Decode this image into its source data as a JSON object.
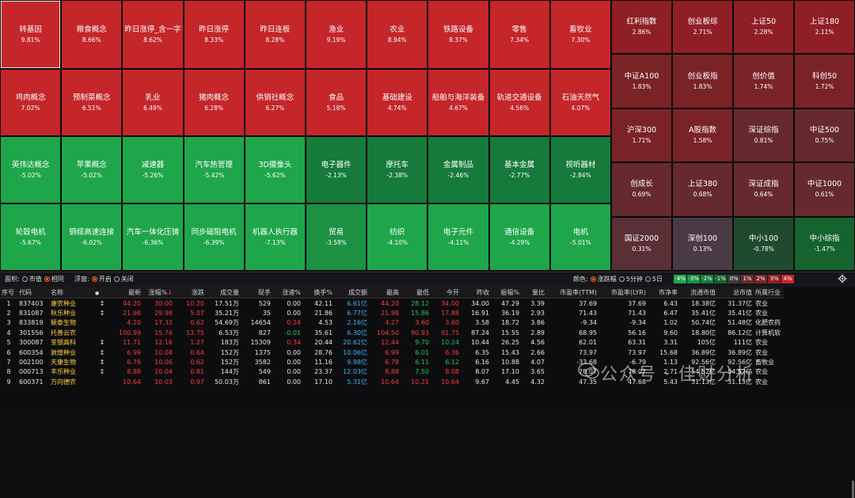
{
  "heatmap": {
    "tiles": [
      {
        "name": "转基因",
        "pct": "9.81%",
        "color": "#c4262a",
        "selected": true
      },
      {
        "name": "粮食概念",
        "pct": "8.66%",
        "color": "#c4262a"
      },
      {
        "name": "昨日涨停_含一字",
        "pct": "8.62%",
        "color": "#c4262a"
      },
      {
        "name": "昨日涨停",
        "pct": "8.33%",
        "color": "#c4262a"
      },
      {
        "name": "昨日连板",
        "pct": "8.28%",
        "color": "#c4262a"
      },
      {
        "name": "渔业",
        "pct": "9.19%",
        "color": "#c4262a"
      },
      {
        "name": "农业",
        "pct": "8.94%",
        "color": "#c4262a"
      },
      {
        "name": "铁路设备",
        "pct": "8.37%",
        "color": "#c4262a"
      },
      {
        "name": "零售",
        "pct": "7.34%",
        "color": "#c4262a"
      },
      {
        "name": "畜牧业",
        "pct": "7.30%",
        "color": "#c4262a"
      },
      {
        "name": "鸡肉概念",
        "pct": "7.02%",
        "color": "#c4262a"
      },
      {
        "name": "预制菜概念",
        "pct": "6.51%",
        "color": "#c4262a"
      },
      {
        "name": "乳业",
        "pct": "6.49%",
        "color": "#c4262a"
      },
      {
        "name": "猪肉概念",
        "pct": "6.28%",
        "color": "#c4262a"
      },
      {
        "name": "供销社概念",
        "pct": "6.27%",
        "color": "#c4262a"
      },
      {
        "name": "食品",
        "pct": "5.18%",
        "color": "#c4262a"
      },
      {
        "name": "基础建设",
        "pct": "4.74%",
        "color": "#c4262a"
      },
      {
        "name": "船舶与海洋装备",
        "pct": "4.67%",
        "color": "#c4262a"
      },
      {
        "name": "轨道交通设备",
        "pct": "4.56%",
        "color": "#c4262a"
      },
      {
        "name": "石油天然气",
        "pct": "4.07%",
        "color": "#c4262a"
      },
      {
        "name": "英伟达概念",
        "pct": "-5.02%",
        "color": "#1fa64a"
      },
      {
        "name": "苹果概念",
        "pct": "-5.02%",
        "color": "#1fa64a"
      },
      {
        "name": "减速器",
        "pct": "-5.26%",
        "color": "#1fa64a"
      },
      {
        "name": "汽车热管理",
        "pct": "-5.42%",
        "color": "#1fa64a"
      },
      {
        "name": "3D摄像头",
        "pct": "-5.62%",
        "color": "#1fa64a"
      },
      {
        "name": "电子器件",
        "pct": "-2.13%",
        "color": "#167a3a"
      },
      {
        "name": "摩托车",
        "pct": "-2.38%",
        "color": "#167a3a"
      },
      {
        "name": "金属制品",
        "pct": "-2.46%",
        "color": "#167a3a"
      },
      {
        "name": "基本金属",
        "pct": "-2.77%",
        "color": "#167a3a"
      },
      {
        "name": "视听器材",
        "pct": "-2.84%",
        "color": "#167a3a"
      },
      {
        "name": "轮毂电机",
        "pct": "-5.67%",
        "color": "#1fa64a"
      },
      {
        "name": "铜缆高速连接",
        "pct": "-6.02%",
        "color": "#1fa64a"
      },
      {
        "name": "汽车一体化压铸",
        "pct": "-6.36%",
        "color": "#1fa64a"
      },
      {
        "name": "同步磁阻电机",
        "pct": "-6.39%",
        "color": "#1fa64a"
      },
      {
        "name": "机器人执行器",
        "pct": "-7.13%",
        "color": "#1fa64a"
      },
      {
        "name": "贸易",
        "pct": "-3.58%",
        "color": "#1c9142"
      },
      {
        "name": "纺织",
        "pct": "-4.10%",
        "color": "#1fa64a"
      },
      {
        "name": "电子元件",
        "pct": "-4.11%",
        "color": "#1fa64a"
      },
      {
        "name": "通信设备",
        "pct": "-4.29%",
        "color": "#1fa64a"
      },
      {
        "name": "电机",
        "pct": "-5.01%",
        "color": "#1fa64a"
      }
    ],
    "index_tiles": [
      {
        "name": "红利指数",
        "pct": "2.86%",
        "color": "#8f1f25"
      },
      {
        "name": "创业板综",
        "pct": "2.71%",
        "color": "#8f1f25"
      },
      {
        "name": "上证50",
        "pct": "2.28%",
        "color": "#8f1f25"
      },
      {
        "name": "上证180",
        "pct": "2.11%",
        "color": "#8f1f25"
      },
      {
        "name": "中证A100",
        "pct": "1.83%",
        "color": "#7a2327"
      },
      {
        "name": "创业板指",
        "pct": "1.83%",
        "color": "#7a2327"
      },
      {
        "name": "创价值",
        "pct": "1.74%",
        "color": "#7a2327"
      },
      {
        "name": "科创50",
        "pct": "1.72%",
        "color": "#7a2327"
      },
      {
        "name": "沪深300",
        "pct": "1.71%",
        "color": "#7a2327"
      },
      {
        "name": "A股指数",
        "pct": "1.58%",
        "color": "#7a2327"
      },
      {
        "name": "深证综指",
        "pct": "0.81%",
        "color": "#662a2e"
      },
      {
        "name": "中证500",
        "pct": "0.75%",
        "color": "#662a2e"
      },
      {
        "name": "创成长",
        "pct": "0.69%",
        "color": "#662a2e"
      },
      {
        "name": "上证380",
        "pct": "0.68%",
        "color": "#662a2e"
      },
      {
        "name": "深证成指",
        "pct": "0.64%",
        "color": "#662a2e"
      },
      {
        "name": "中证1000",
        "pct": "0.61%",
        "color": "#662a2e"
      },
      {
        "name": "国证2000",
        "pct": "0.31%",
        "color": "#5a3036"
      },
      {
        "name": "深创100",
        "pct": "0.13%",
        "color": "#4a3a44"
      },
      {
        "name": "中小100",
        "pct": "-0.78%",
        "color": "#1f4a2e"
      },
      {
        "name": "中小综指",
        "pct": "-1.47%",
        "color": "#15632e"
      }
    ]
  },
  "controls": {
    "area_label": "面积:",
    "area_opts": [
      "市值",
      "相同"
    ],
    "area_selected": 1,
    "float_label": "浮窗:",
    "float_opts": [
      "开启",
      "关闭"
    ],
    "float_selected": 0,
    "color_label": "颜色:",
    "color_opts": [
      "涨跌幅",
      "5分钟",
      "5日"
    ],
    "color_selected": 0,
    "legend": [
      {
        "t": "-4%",
        "c": "#1fa64a"
      },
      {
        "t": "-3%",
        "c": "#1c9142"
      },
      {
        "t": "-2%",
        "c": "#167a3a"
      },
      {
        "t": "-1%",
        "c": "#15632e"
      },
      {
        "t": "0%",
        "c": "#3a3a3a"
      },
      {
        "t": "1%",
        "c": "#662a2e"
      },
      {
        "t": "2%",
        "c": "#7a2327"
      },
      {
        "t": "3%",
        "c": "#8f1f25"
      },
      {
        "t": "4%",
        "c": "#c4262a"
      }
    ]
  },
  "table": {
    "headers": [
      "序号",
      "代码",
      "名称",
      "",
      "最新",
      "涨幅%",
      "涨跌",
      "成交量",
      "现手",
      "涨速%",
      "换手%",
      "成交额",
      "最高",
      "最低",
      "今开",
      "昨收",
      "振幅%",
      "量比",
      "市盈率(TTM)",
      "市盈率(LYR)",
      "市净率",
      "流通市值",
      "总市值",
      "所属行业"
    ],
    "sort_arrow": "↓",
    "rows": [
      [
        "1",
        "837403",
        "康农种业",
        "↕",
        "44.20",
        "30.00",
        "10.20",
        "17.51万",
        "529",
        "0.00",
        "42.11",
        "6.61亿",
        "44.20",
        "28.12",
        "34.00",
        "34.00",
        "47.29",
        "3.39",
        "37.69",
        "37.69",
        "6.43",
        "18.38亿",
        "31.37亿",
        "农业"
      ],
      [
        "2",
        "831087",
        "秋乐种业",
        "↕",
        "21.98",
        "29.98",
        "5.07",
        "35.21万",
        "35",
        "0.00",
        "21.86",
        "6.77亿",
        "21.98",
        "15.86",
        "17.88",
        "16.91",
        "36.19",
        "2.93",
        "71.43",
        "71.43",
        "6.47",
        "35.41亿",
        "35.41亿",
        "农业"
      ],
      [
        "3",
        "833819",
        "颖泰生物",
        "",
        "4.20",
        "17.32",
        "0.62",
        "54.69万",
        "14654",
        "0.24",
        "4.53",
        "2.16亿",
        "4.27",
        "3.60",
        "3.60",
        "3.58",
        "18.72",
        "3.86",
        "-9.34",
        "-9.34",
        "1.02",
        "50.74亿",
        "51.48亿",
        "化肥农药"
      ],
      [
        "4",
        "301556",
        "托普云农",
        "",
        "100.99",
        "15.76",
        "13.75",
        "6.53万",
        "827",
        "-0.01",
        "35.61",
        "6.30亿",
        "104.50",
        "90.93",
        "91.75",
        "87.24",
        "15.55",
        "2.89",
        "68.95",
        "56.16",
        "9.60",
        "18.80亿",
        "86.12亿",
        "计算机软"
      ],
      [
        "5",
        "300087",
        "荃银高科",
        "↕",
        "11.71",
        "12.16",
        "1.27",
        "183万",
        "15309",
        "0.34",
        "20.44",
        "20.62亿",
        "12.44",
        "9.70",
        "10.24",
        "10.44",
        "26.25",
        "4.56",
        "62.01",
        "63.31",
        "3.31",
        "105亿",
        "111亿",
        "农业"
      ],
      [
        "6",
        "600354",
        "敦煌种业",
        "↕",
        "6.99",
        "10.08",
        "0.64",
        "152万",
        "1375",
        "0.00",
        "28.76",
        "10.06亿",
        "6.99",
        "6.01",
        "6.36",
        "6.35",
        "15.43",
        "2.66",
        "73.97",
        "73.97",
        "15.68",
        "36.89亿",
        "36.89亿",
        "农业"
      ],
      [
        "7",
        "002100",
        "天康生物",
        "↕",
        "6.78",
        "10.06",
        "0.62",
        "152万",
        "3582",
        "0.00",
        "11.16",
        "9.98亿",
        "6.78",
        "6.11",
        "6.12",
        "6.16",
        "10.88",
        "4.07",
        "-33.68",
        "-6.79",
        "1.13",
        "92.56亿",
        "92.56亿",
        "畜牧业"
      ],
      [
        "8",
        "000713",
        "丰乐种业",
        "↕",
        "8.88",
        "10.04",
        "0.81",
        "144万",
        "549",
        "0.00",
        "23.37",
        "12.03亿",
        "8.88",
        "7.50",
        "8.08",
        "8.07",
        "17.10",
        "3.65",
        "78.07",
        "78.07",
        "2.71",
        "54.52亿",
        "54.52亿",
        "农业"
      ],
      [
        "9",
        "600371",
        "万向德农",
        "",
        "10.64",
        "10.03",
        "0.97",
        "50.03万",
        "861",
        "0.00",
        "17.10",
        "5.31亿",
        "10.64",
        "10.21",
        "10.64",
        "9.67",
        "4.45",
        "4.32",
        "47.35",
        "47.68",
        "5.43",
        "31.13亿",
        "31.13亿",
        "农业"
      ]
    ],
    "row_classes": [
      {
        "last": "up",
        "chg": "up",
        "hi": "up",
        "lo": "dn",
        "op": "up"
      },
      {
        "last": "up",
        "chg": "up",
        "hi": "up",
        "lo": "dn",
        "op": "up"
      },
      {
        "last": "up",
        "chg": "up",
        "hi": "up",
        "lo": "up",
        "op": "up"
      },
      {
        "last": "up",
        "chg": "up",
        "hi": "up",
        "lo": "up",
        "op": "up"
      },
      {
        "last": "up",
        "chg": "up",
        "hi": "up",
        "lo": "dn",
        "op": "dn"
      },
      {
        "last": "up",
        "chg": "up",
        "hi": "up",
        "lo": "dn",
        "op": "up"
      },
      {
        "last": "up",
        "chg": "up",
        "hi": "up",
        "lo": "dn",
        "op": "dn"
      },
      {
        "last": "up",
        "chg": "up",
        "hi": "up",
        "lo": "dn",
        "op": "up"
      },
      {
        "last": "up",
        "chg": "up",
        "hi": "up",
        "lo": "up",
        "op": "up"
      }
    ]
  },
  "watermark": {
    "text": "公众号 · 佳财分析"
  }
}
